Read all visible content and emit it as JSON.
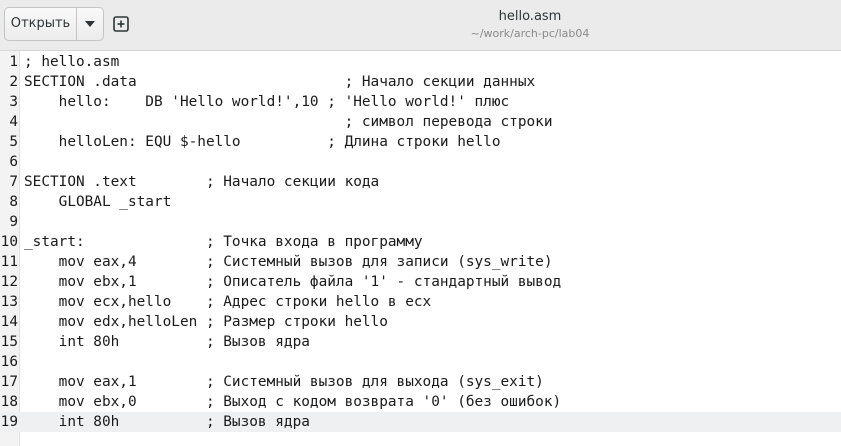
{
  "header": {
    "open_label": "Открыть",
    "title": "hello.asm",
    "subtitle": "~/work/arch-pc/lab04"
  },
  "editor": {
    "current_line": 19,
    "lines": [
      {
        "n": "1",
        "text": "; hello.asm"
      },
      {
        "n": "2",
        "text": "SECTION .data                        ; Начало секции данных"
      },
      {
        "n": "3",
        "text": "    hello:    DB 'Hello world!',10 ; 'Hello world!' плюс"
      },
      {
        "n": "4",
        "text": "                                     ; символ перевода строки"
      },
      {
        "n": "5",
        "text": "    helloLen: EQU $-hello          ; Длина строки hello"
      },
      {
        "n": "6",
        "text": ""
      },
      {
        "n": "7",
        "text": "SECTION .text        ; Начало секции кода"
      },
      {
        "n": "8",
        "text": "    GLOBAL _start"
      },
      {
        "n": "9",
        "text": ""
      },
      {
        "n": "10",
        "text": "_start:              ; Точка входа в программу"
      },
      {
        "n": "11",
        "text": "    mov eax,4        ; Системный вызов для записи (sys_write)"
      },
      {
        "n": "12",
        "text": "    mov ebx,1        ; Описатель файла '1' - стандартный вывод"
      },
      {
        "n": "13",
        "text": "    mov ecx,hello    ; Адрес строки hello в ecx"
      },
      {
        "n": "14",
        "text": "    mov edx,helloLen ; Размер строки hello"
      },
      {
        "n": "15",
        "text": "    int 80h          ; Вызов ядра"
      },
      {
        "n": "16",
        "text": ""
      },
      {
        "n": "17",
        "text": "    mov eax,1        ; Системный вызов для выхода (sys_exit)"
      },
      {
        "n": "18",
        "text": "    mov ebx,0        ; Выход с кодом возврата '0' (без ошибок)"
      },
      {
        "n": "19",
        "text": "    int 80h          ; Вызов ядра"
      }
    ]
  },
  "icons": {
    "menu": "chevron-down-icon",
    "new_tab": "new-tab-icon"
  }
}
